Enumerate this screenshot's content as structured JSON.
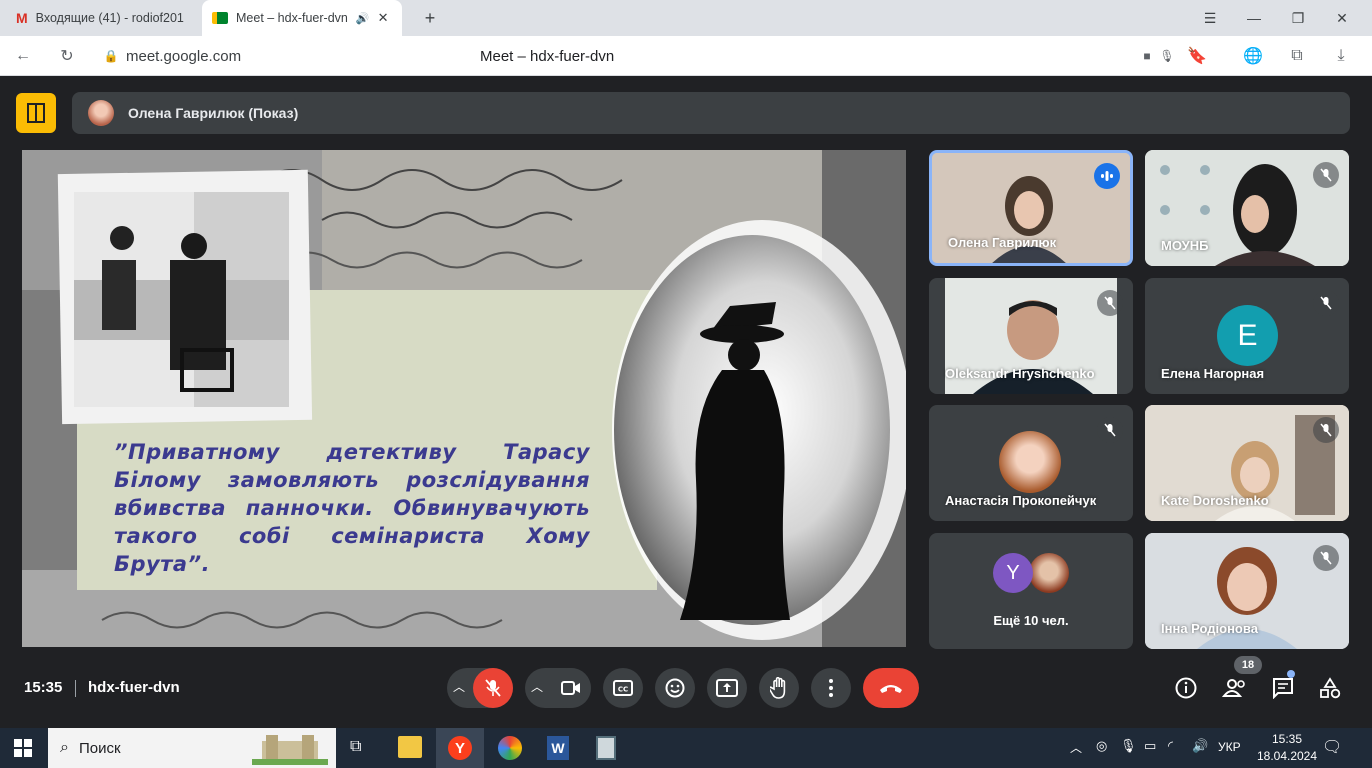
{
  "browser": {
    "tabs": [
      {
        "title": "Входящие (41) - rodiof201",
        "icon": "gmail-icon"
      },
      {
        "title": "Meet – hdx-fuer-dvn",
        "icon": "meet-icon",
        "active": true
      }
    ],
    "new_tab": "+",
    "address": "meet.google.com",
    "page_title": "Meet – hdx-fuer-dvn"
  },
  "meet": {
    "presenter_label": "Олена Гаврилюк (Показ)",
    "slide": {
      "quote": "”Приватному детективу Тарасу Білому замовляють розслідування вбивства панночки. Обвинувачують такого собі семінариста Хому Брута”."
    },
    "participants": [
      {
        "name": "Олена Гаврилюк",
        "speaking": true
      },
      {
        "name": "МОУНБ"
      },
      {
        "name": "Oleksandr Hryshchenko"
      },
      {
        "name": "Елена Нагорная",
        "avatar_letter": "E",
        "avatar_color": "#129eaf"
      },
      {
        "name": "Анастасія Прокопейчук"
      },
      {
        "name": "Kate Doroshenko"
      },
      {
        "name": "Ещё 10 чел.",
        "avatar_letter": "Y",
        "avatar_color": "#7e57c2"
      },
      {
        "name": "Інна Родіонова"
      }
    ],
    "bottom": {
      "time": "15:35",
      "meeting_code": "hdx-fuer-dvn",
      "participants_count": "18"
    },
    "colors": {
      "accent": "#8ab4f8",
      "end_call": "#ea4335",
      "layout_btn": "#fbbc04"
    }
  },
  "taskbar": {
    "search_placeholder": "Поиск",
    "lang": "УКР",
    "clock_time": "15:35",
    "clock_date": "18.04.2024"
  }
}
